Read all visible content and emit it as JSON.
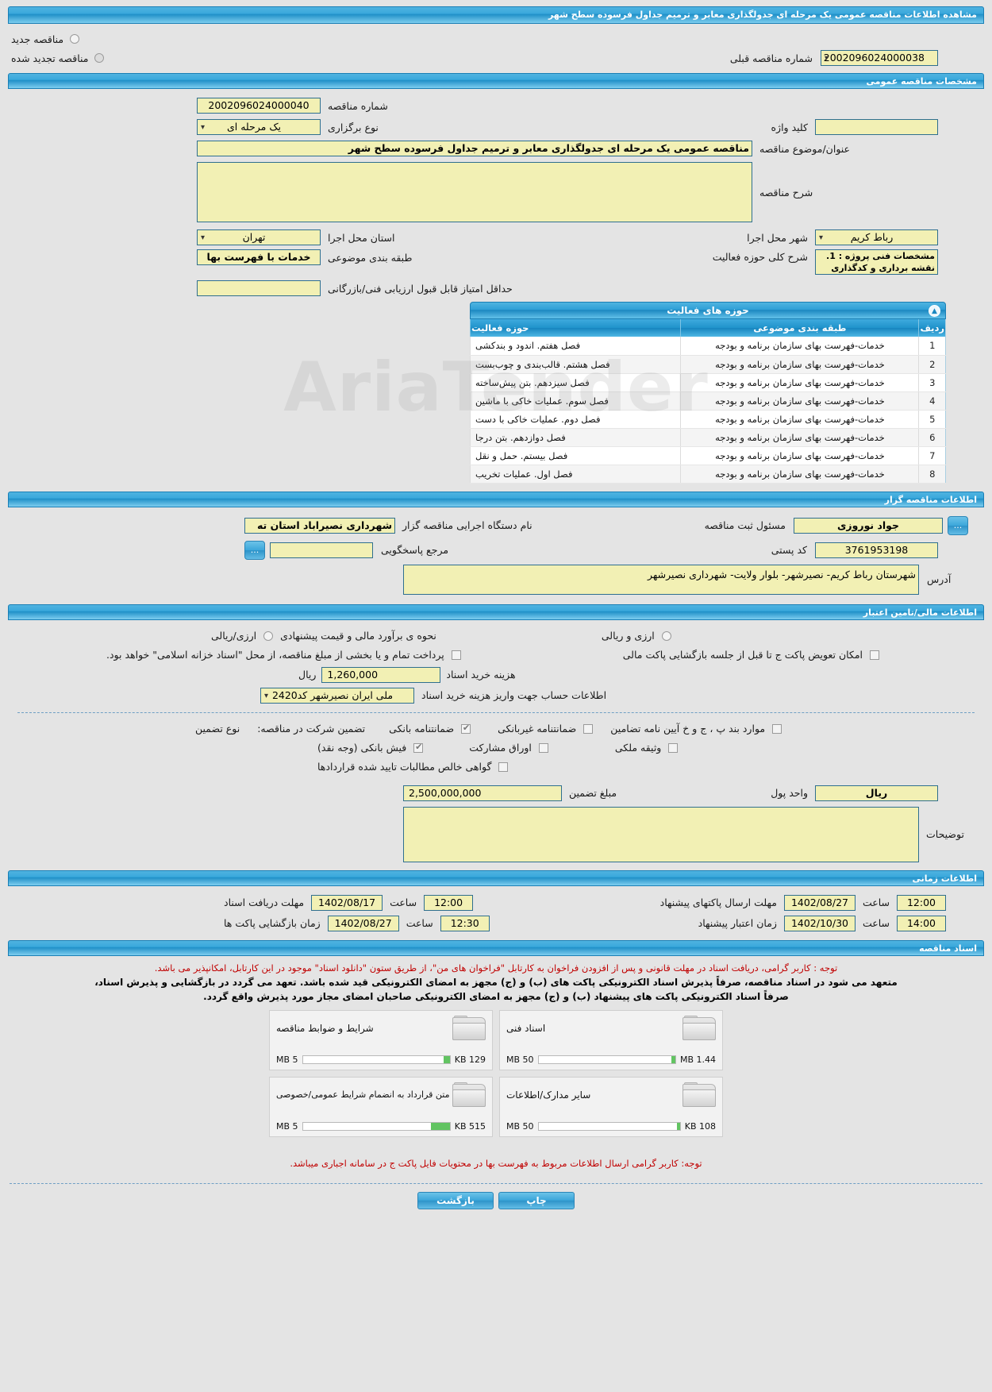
{
  "page_title": "مشاهده اطلاعات مناقصه عمومی یک مرحله ای جدولگذاری معابر و ترمیم جداول فرسوده سطح شهر",
  "top": {
    "new_tender_label": "مناقصه جدید",
    "renewed_tender_label": "مناقصه تجدید شده",
    "prev_tender_label": "شماره مناقصه قبلی",
    "prev_tender_value": "2002096024000038"
  },
  "general": {
    "section_title": "مشخصات مناقصه عمومی",
    "tender_no_label": "شماره مناقصه",
    "tender_no_value": "2002096024000040",
    "type_label": "نوع برگزاری",
    "type_value": "یک مرحله ای",
    "keyword_label": "کلید واژه",
    "keyword_value": "",
    "subject_label": "عنوان/موضوع مناقصه",
    "subject_value": "مناقصه عمومی یک مرحله ای جدولگذاری معابر و ترمیم جداول فرسوده سطح شهر",
    "description_label": "شرح مناقصه",
    "description_value": "",
    "province_label": "استان محل اجرا",
    "province_value": "تهران",
    "city_label": "شهر محل اجرا",
    "city_value": "رباط کریم",
    "category_label": "طبقه بندی موضوعی",
    "category_value": "خدمات با فهرست بها",
    "activity_desc_label": "شرح کلی حوزه فعالیت",
    "activity_desc_value": "مشخصات فنی پروژه :\n1.    نقشه برداری و کدگذاری",
    "min_score_label": "حداقل امتیاز قابل قبول ارزیابی فنی/بازرگانی",
    "min_score_value": ""
  },
  "activities": {
    "section_title": "حوزه های فعالیت",
    "columns": {
      "row": "ردیف",
      "category": "طبقه بندی موضوعی",
      "area": "حوزه فعالیت"
    },
    "rows": [
      {
        "row": "1",
        "category": "خدمات-فهرست بهای سازمان برنامه و بودجه",
        "area": "فصل هفتم. اندود و بندکشی"
      },
      {
        "row": "2",
        "category": "خدمات-فهرست بهای سازمان برنامه و بودجه",
        "area": "فصل هشتم. قالب‌بندی و چوب‌بست"
      },
      {
        "row": "3",
        "category": "خدمات-فهرست بهای سازمان برنامه و بودجه",
        "area": "فصل سیزدهم. بتن پیش‌ساخته"
      },
      {
        "row": "4",
        "category": "خدمات-فهرست بهای سازمان برنامه و بودجه",
        "area": "فصل سوم. عملیات خاکی با ماشین"
      },
      {
        "row": "5",
        "category": "خدمات-فهرست بهای سازمان برنامه و بودجه",
        "area": "فصل دوم. عملیات خاکی با دست"
      },
      {
        "row": "6",
        "category": "خدمات-فهرست بهای سازمان برنامه و بودجه",
        "area": "فصل دوازدهم. بتن درجا"
      },
      {
        "row": "7",
        "category": "خدمات-فهرست بهای سازمان برنامه و بودجه",
        "area": "فصل بیستم. حمل و نقل"
      },
      {
        "row": "8",
        "category": "خدمات-فهرست بهای سازمان برنامه و بودجه",
        "area": "فصل اول. عملیات تخریب"
      }
    ]
  },
  "organizer": {
    "section_title": "اطلاعات مناقصه گزار",
    "agency_label": "نام دستگاه اجرایی مناقصه گزار",
    "agency_value": "شهرداری نصیراباد استان ته",
    "registrar_label": "مسئول ثبت مناقصه",
    "registrar_value": "جواد نوروزی",
    "contact_label": "مرجع پاسخگویی",
    "contact_value": "",
    "postal_label": "کد پستی",
    "postal_value": "3761953198",
    "address_label": "آدرس",
    "address_value": "شهرستان رباط کریم- نصیرشهر- بلوار ولایت- شهرداری نصیرشهر",
    "dots_label": "..."
  },
  "financial": {
    "section_title": "اطلاعات مالی/تامین اعتبار",
    "estimate_label": "نحوه ی برآورد مالی و قیمت پیشنهادی",
    "option_rial": "ارزی/ریالی",
    "option_currency_rial": "ارزی و ریالی",
    "payment_note": "پرداخت تمام و یا بخشی از مبلغ مناقصه، از محل \"اسناد خزانه اسلامی\" خواهد بود.",
    "envelope_swap_label": "امکان تعویض پاکت ج تا قبل از جلسه بازگشایی پاکت مالی",
    "doc_cost_label": "هزینه خرید اسناد",
    "doc_cost_value": "1,260,000",
    "doc_cost_unit": "ریال",
    "account_label": "اطلاعات حساب جهت واریز هزینه خرید اسناد",
    "account_value": "ملی ایران نصیرشهر کد2420",
    "guarantee_title": "تضمین شرکت در مناقصه:",
    "guarantee_type_label": "نوع تضمین",
    "guarantee_options": [
      {
        "label": "ضمانتنامه بانکی",
        "checked": true
      },
      {
        "label": "ضمانتنامه غیربانکی",
        "checked": false
      },
      {
        "label": "موارد بند پ ، ج و خ آیین نامه تضامین",
        "checked": false
      },
      {
        "label": "فیش بانکی (وجه نقد)",
        "checked": true
      },
      {
        "label": "اوراق مشارکت",
        "checked": false
      },
      {
        "label": "وثیقه ملکی",
        "checked": false
      },
      {
        "label": "گواهی خالص مطالبات تایید شده قراردادها",
        "checked": false
      }
    ],
    "guarantee_amount_label": "مبلغ تضمین",
    "guarantee_amount_value": "2,500,000,000",
    "currency_unit_label": "واحد پول",
    "currency_unit_value": "ریال",
    "remarks_label": "توضیحات",
    "remarks_value": ""
  },
  "timing": {
    "section_title": "اطلاعات زمانی",
    "time_label": "ساعت",
    "receive_docs_label": "مهلت دریافت اسناد",
    "receive_docs_date": "1402/08/17",
    "receive_docs_time": "12:00",
    "open_envelopes_label": "زمان بازگشایی پاکت ها",
    "open_envelopes_date": "1402/08/27",
    "open_envelopes_time": "12:30",
    "submit_label": "مهلت ارسال پاکتهای پیشنهاد",
    "submit_date": "1402/08/27",
    "submit_time": "12:00",
    "validity_label": "زمان اعتبار پیشنهاد",
    "validity_date": "1402/10/30",
    "validity_time": "14:00"
  },
  "documents": {
    "section_title": "اسناد مناقصه",
    "note_red": "توجه : کاربر گرامی، دریافت اسناد در مهلت قانونی و پس از افزودن فراخوان به کارتابل \"فراخوان های من\"، از طریق ستون \"دانلود اسناد\" موجود در این کارتابل، امکانپذیر می باشد.",
    "note_bold_1": "متعهد می شود در اسناد مناقصه، صرفاً پذیرش اسناد الکترونیکی پاکت های (ب) و (ج) مجهز به امضای الکترونیکی قید شده باشد. تعهد می گردد در بازگشایی و پذیرش اسناد،",
    "note_bold_2": "صرفاً اسناد الکترونیکی پاکت های پیشنهاد (ب) و (ج) مجهز به امضای الکترونیکی صاحبان امضای مجاز مورد پذیرش واقع گردد.",
    "cards": [
      {
        "title": "شرایط و ضوابط مناقصه",
        "size": "129 KB",
        "max": "5 MB",
        "fill": 4
      },
      {
        "title": "اسناد فنی",
        "size": "1.44 MB",
        "max": "50 MB",
        "fill": 3
      },
      {
        "title": "متن قرارداد به انضمام شرایط عمومی/خصوصی",
        "size": "515 KB",
        "max": "5 MB",
        "fill": 13
      },
      {
        "title": "سایر مدارک/اطلاعات",
        "size": "108 KB",
        "max": "50 MB",
        "fill": 2
      }
    ],
    "footer_note": "توجه: کاربر گرامی ارسال اطلاعات مربوط به فهرست بها در محتویات فایل پاکت ج در سامانه اجباری میباشد."
  },
  "footer": {
    "print_label": "چاپ",
    "back_label": "بازگشت"
  }
}
